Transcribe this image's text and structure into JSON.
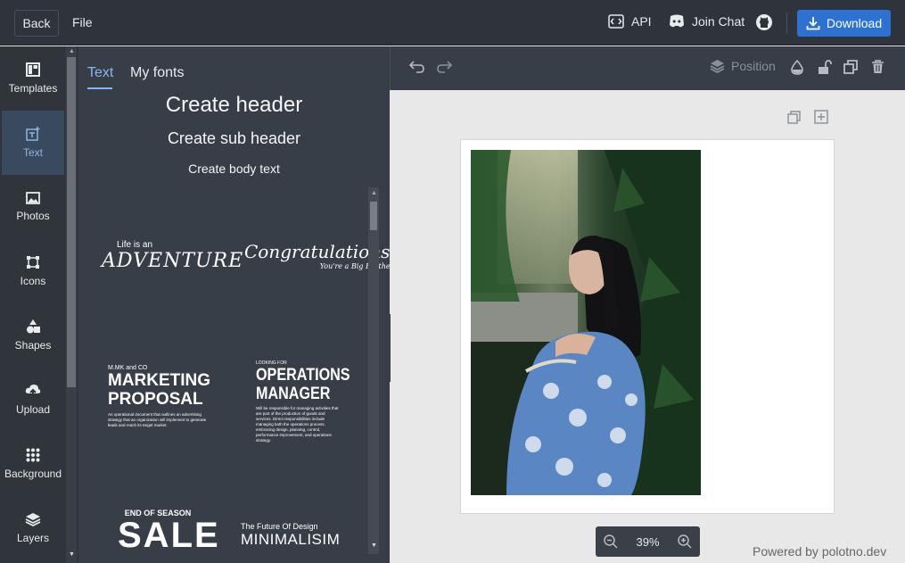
{
  "topbar": {
    "back_label": "Back",
    "file_label": "File",
    "api_label": "API",
    "chat_label": "Join Chat",
    "download_label": "Download",
    "accent_color": "#2d72d2"
  },
  "sidebar": {
    "items": [
      {
        "label": "Templates",
        "icon": "templates-icon"
      },
      {
        "label": "Text",
        "icon": "text-icon",
        "active": true
      },
      {
        "label": "Photos",
        "icon": "photos-icon"
      },
      {
        "label": "Icons",
        "icon": "icons-icon"
      },
      {
        "label": "Shapes",
        "icon": "shapes-icon"
      },
      {
        "label": "Upload",
        "icon": "upload-icon"
      },
      {
        "label": "Background",
        "icon": "background-icon"
      },
      {
        "label": "Layers",
        "icon": "layers-icon"
      }
    ]
  },
  "panel": {
    "tabs": [
      "Text",
      "My fonts"
    ],
    "create_header": "Create header",
    "create_subheader": "Create sub header",
    "create_body": "Create body text",
    "templates": {
      "adventure": {
        "small": "Life is an",
        "big": "ADVENTURE"
      },
      "congrats": {
        "big": "Congratulations!",
        "sub": "You're a Big Brother"
      },
      "marketing": {
        "small": "M.MK and CO",
        "line1": "MARKETING",
        "line2": "PROPOSAL",
        "desc": "An operational document that outlines an advertising strategy that an organization will implement to generate leads and reach its target market."
      },
      "operations": {
        "small": "LOOKING FOR",
        "line1": "OPERATIONS",
        "line2": "MANAGER",
        "desc": "Will be responsible for managing activities that are part of the production of goods and services. Direct responsibilities include managing both the operations process, embracing design, planning, control, performance improvement, and operations strategy."
      },
      "sale": {
        "small": "END OF SEASON",
        "big": "SALE"
      },
      "minimalism": {
        "small": "The Future Of Design",
        "big": "MINIMALISIM"
      }
    }
  },
  "toolbar": {
    "position_label": "Position"
  },
  "workspace": {
    "zoom_label": "39%",
    "powered_by": "Powered by polotno.dev"
  }
}
